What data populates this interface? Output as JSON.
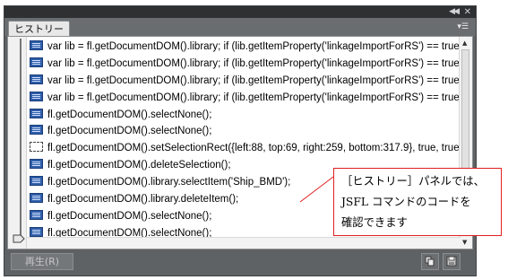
{
  "panel": {
    "tab_label": "ヒストリー",
    "collapse_icon": "double-chevron-right",
    "close_icon": "close-x",
    "menu_icon": "panel-menu"
  },
  "history": {
    "items": [
      {
        "icon": "script-step-icon",
        "text": "var lib = fl.getDocumentDOM().library; if (lib.getItemProperty('linkageImportForRS') == true) {"
      },
      {
        "icon": "script-step-icon",
        "text": "var lib = fl.getDocumentDOM().library; if (lib.getItemProperty('linkageImportForRS') == true) {"
      },
      {
        "icon": "script-step-icon",
        "text": "var lib = fl.getDocumentDOM().library; if (lib.getItemProperty('linkageImportForRS') == true) {"
      },
      {
        "icon": "script-step-icon",
        "text": "var lib = fl.getDocumentDOM().library; if (lib.getItemProperty('linkageImportForRS') == true) {"
      },
      {
        "icon": "script-step-icon",
        "text": "fl.getDocumentDOM().selectNone();"
      },
      {
        "icon": "script-step-icon",
        "text": "fl.getDocumentDOM().selectNone();"
      },
      {
        "icon": "selection-rect-icon",
        "text": "fl.getDocumentDOM().setSelectionRect({left:88, top:69, right:259, bottom:317.9}, true, true"
      },
      {
        "icon": "script-step-icon",
        "text": "fl.getDocumentDOM().deleteSelection();"
      },
      {
        "icon": "script-step-icon",
        "text": "fl.getDocumentDOM().library.selectItem('Ship_BMD');"
      },
      {
        "icon": "script-step-icon",
        "text": "fl.getDocumentDOM().library.deleteItem();"
      },
      {
        "icon": "script-step-icon",
        "text": "fl.getDocumentDOM().selectNone();"
      },
      {
        "icon": "script-step-icon",
        "text": "fl.getDocumentDOM().selectNone();"
      }
    ]
  },
  "bottom": {
    "replay_label": "再生(R)",
    "copy_icon": "copy-steps-icon",
    "save_icon": "save-command-icon"
  },
  "callout": {
    "line1": "［ヒストリー］パネルでは、",
    "line2": "JSFL コマンドのコードを",
    "line3": "確認できます"
  },
  "colors": {
    "panel_bg": "#5f6264",
    "titlebar_bg": "#2e3032",
    "callout_border": "#e02020"
  }
}
